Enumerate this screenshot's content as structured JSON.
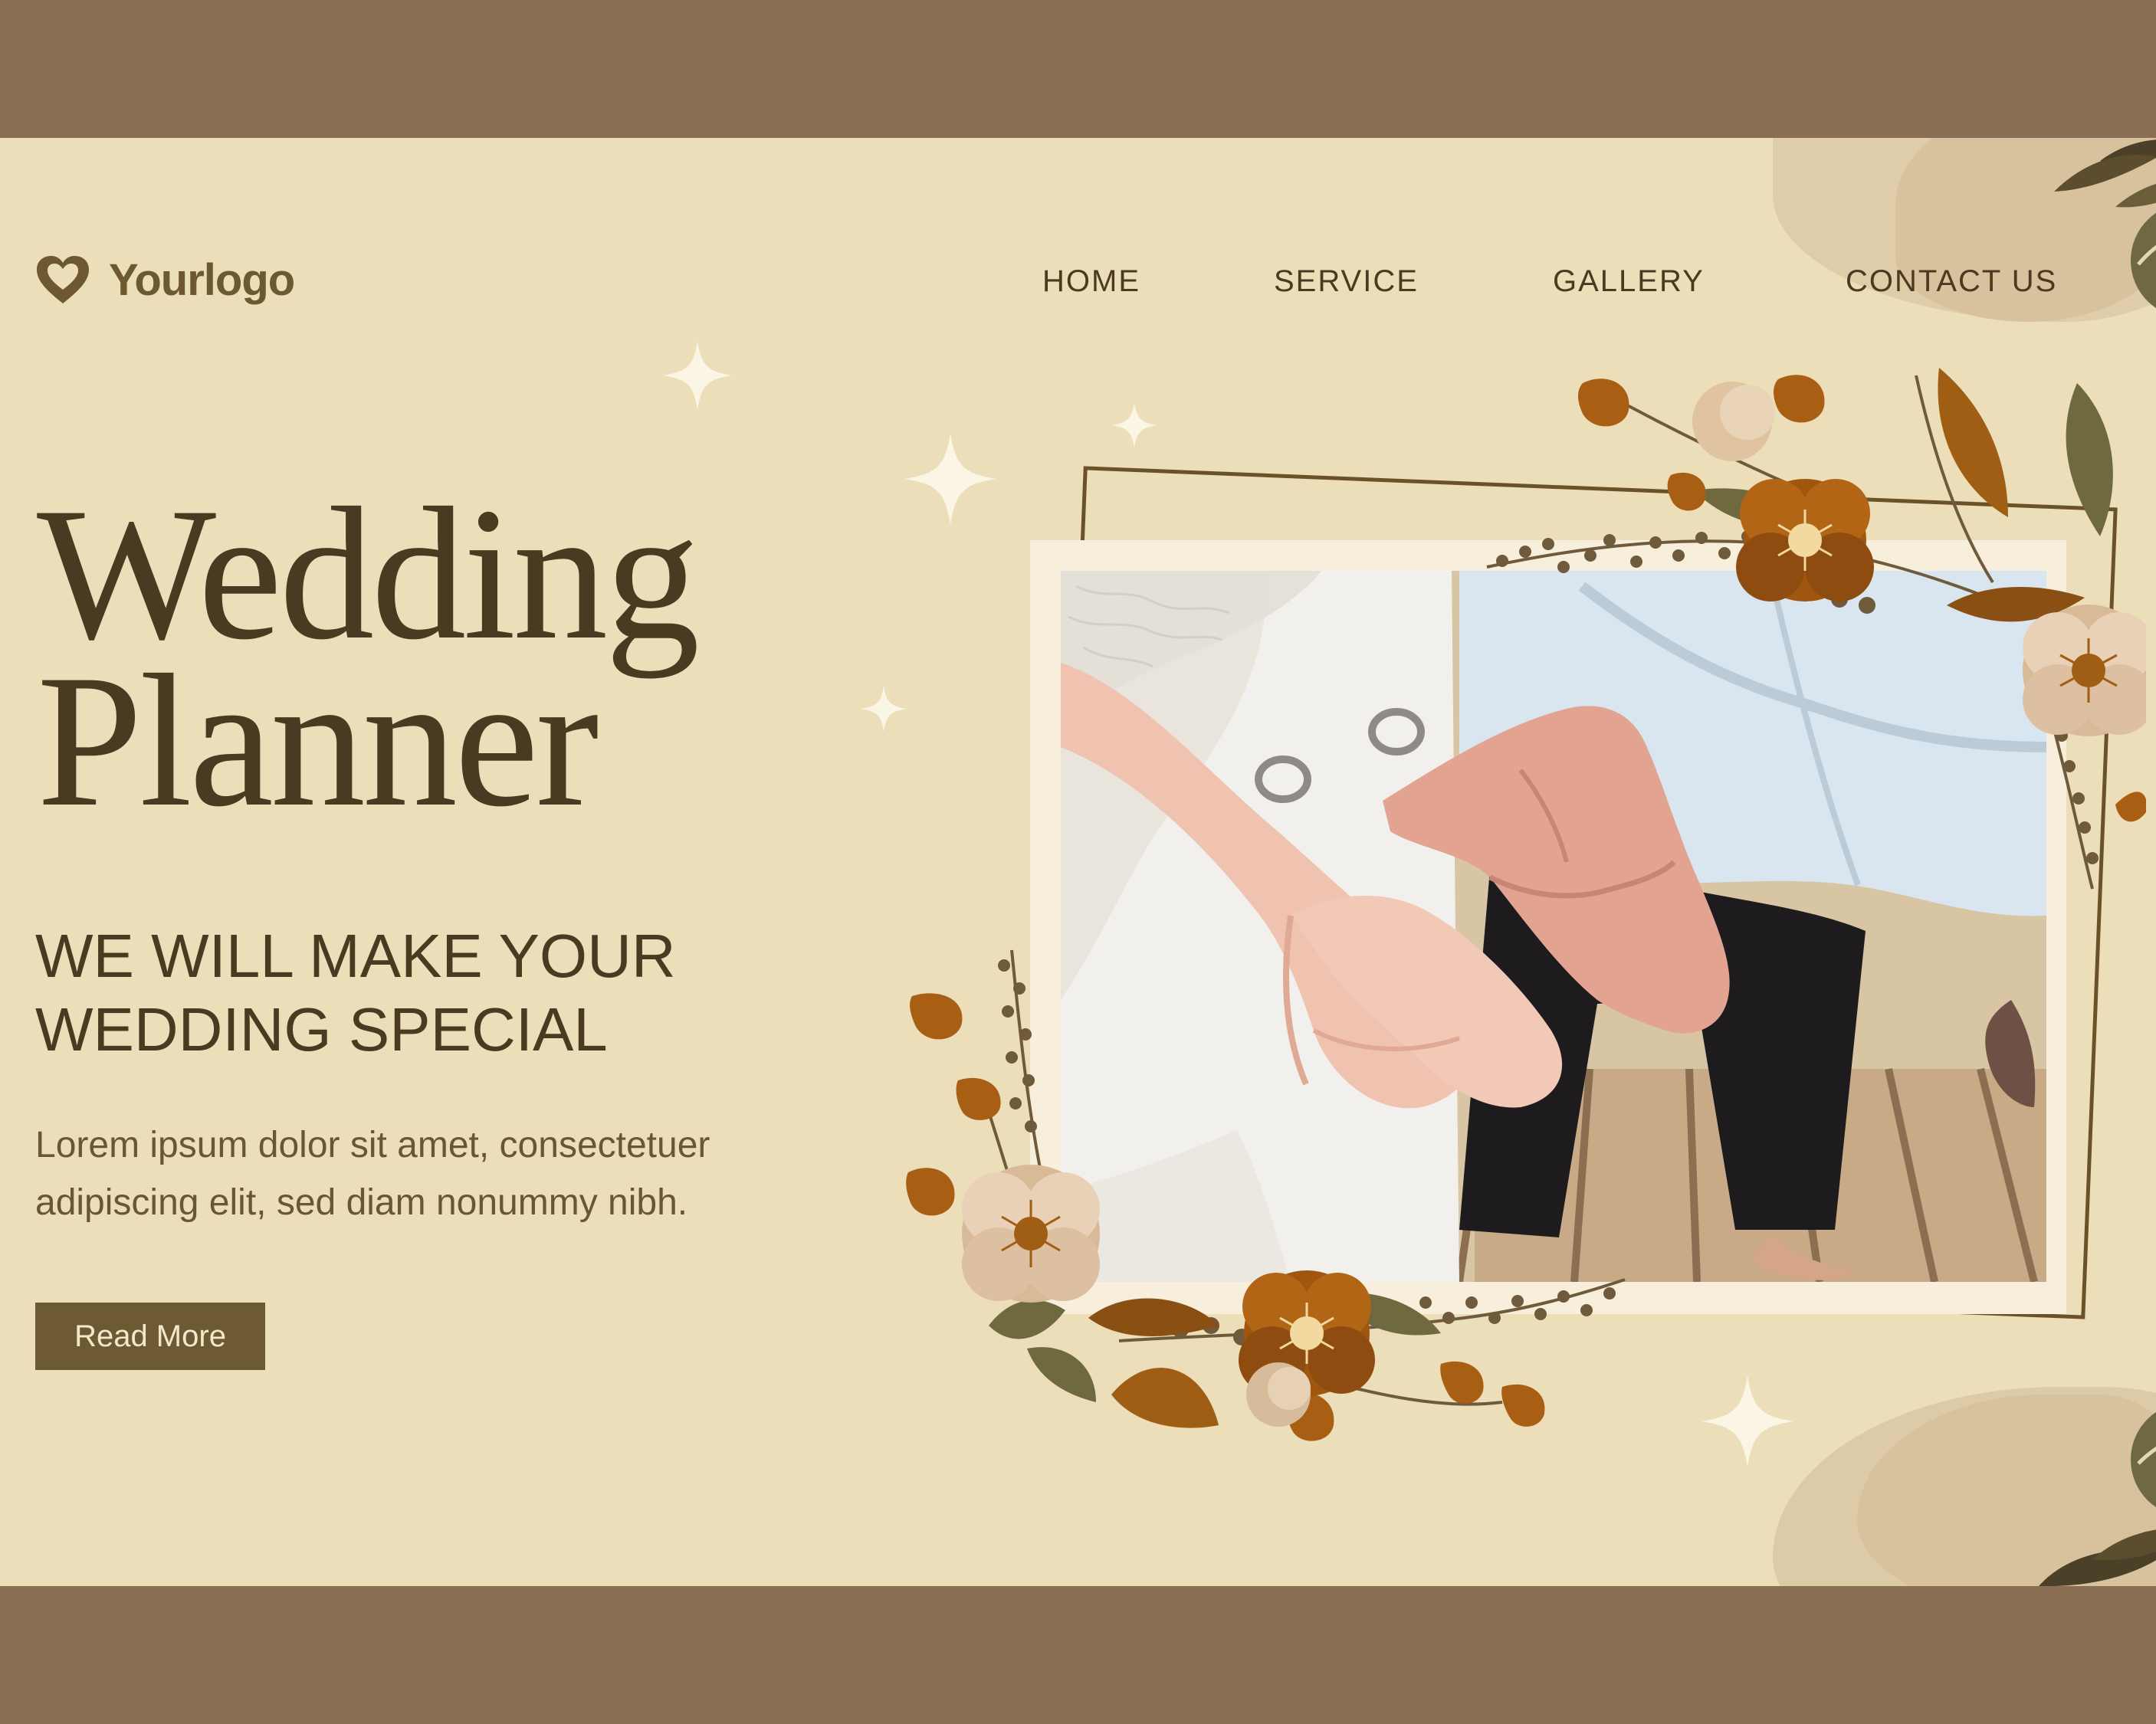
{
  "brand": {
    "logo_text": "Yourlogo"
  },
  "nav": {
    "items": [
      "HOME",
      "SERVICE",
      "GALLERY",
      "CONTACT US"
    ]
  },
  "hero": {
    "title_line1": "Wedding",
    "title_line2": "Planner",
    "subtitle_line1": "WE WILL MAKE YOUR",
    "subtitle_line2": "WEDDING SPECIAL",
    "body_line1": "Lorem ipsum dolor sit amet, consectetuer",
    "body_line2": "adipiscing elit, sed diam nonummy nibh.",
    "cta_label": "Read More"
  },
  "colors": {
    "page_background": "#ecdeb8",
    "outer_band": "#8b6f55",
    "text_dark": "#4a3a22",
    "button": "#6e5a32",
    "accent_brown": "#8a4f12",
    "accent_olive": "#6f6940"
  }
}
